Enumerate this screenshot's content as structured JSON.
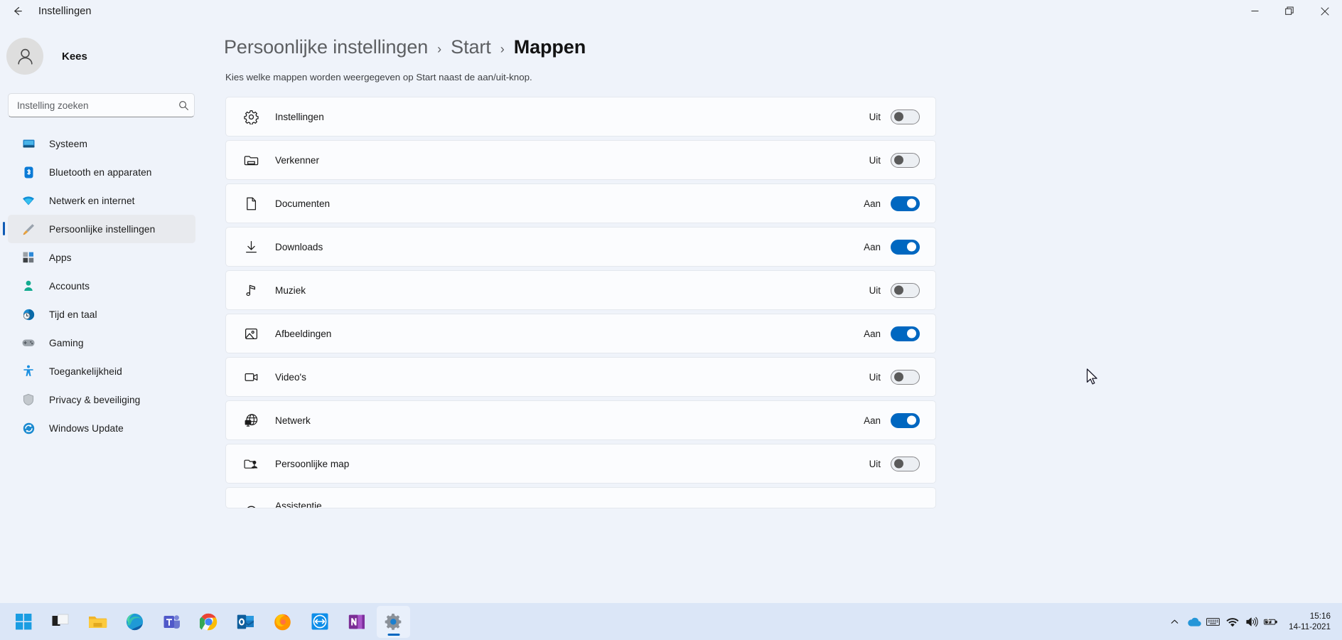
{
  "window": {
    "back_label": "back-arrow",
    "title": "Instellingen",
    "minimize": "minimize",
    "restore": "restore",
    "close": "close"
  },
  "sidebar": {
    "profile_name": "Kees",
    "search": {
      "placeholder": "Instelling zoeken",
      "value": ""
    },
    "items": [
      {
        "label": "Systeem",
        "icon": "monitor-icon",
        "active": false
      },
      {
        "label": "Bluetooth en apparaten",
        "icon": "bluetooth-icon",
        "active": false
      },
      {
        "label": "Netwerk en internet",
        "icon": "wifi-icon",
        "active": false
      },
      {
        "label": "Persoonlijke instellingen",
        "icon": "paintbrush-icon",
        "active": true
      },
      {
        "label": "Apps",
        "icon": "apps-icon",
        "active": false
      },
      {
        "label": "Accounts",
        "icon": "account-icon",
        "active": false
      },
      {
        "label": "Tijd en taal",
        "icon": "clock-globe-icon",
        "active": false
      },
      {
        "label": "Gaming",
        "icon": "gamepad-icon",
        "active": false
      },
      {
        "label": "Toegankelijkheid",
        "icon": "accessibility-icon",
        "active": false
      },
      {
        "label": "Privacy & beveiliging",
        "icon": "shield-icon",
        "active": false
      },
      {
        "label": "Windows Update",
        "icon": "update-icon",
        "active": false
      }
    ]
  },
  "main": {
    "breadcrumb": [
      {
        "label": "Persoonlijke instellingen",
        "current": false
      },
      {
        "label": "Start",
        "current": false
      },
      {
        "label": "Mappen",
        "current": true
      }
    ],
    "separator": "›",
    "description": "Kies welke mappen worden weergegeven op Start naast de aan/uit-knop.",
    "rows": [
      {
        "label": "Instellingen",
        "icon": "gear-icon",
        "state": "Uit",
        "on": false
      },
      {
        "label": "Verkenner",
        "icon": "folder-icon",
        "state": "Uit",
        "on": false
      },
      {
        "label": "Documenten",
        "icon": "document-icon",
        "state": "Aan",
        "on": true
      },
      {
        "label": "Downloads",
        "icon": "download-icon",
        "state": "Aan",
        "on": true
      },
      {
        "label": "Muziek",
        "icon": "music-note-icon",
        "state": "Uit",
        "on": false
      },
      {
        "label": "Afbeeldingen",
        "icon": "image-icon",
        "state": "Aan",
        "on": true
      },
      {
        "label": "Video's",
        "icon": "video-camera-icon",
        "state": "Uit",
        "on": false
      },
      {
        "label": "Netwerk",
        "icon": "network-globe-icon",
        "state": "Aan",
        "on": true
      },
      {
        "label": "Persoonlijke map",
        "icon": "personal-folder-icon",
        "state": "Uit",
        "on": false
      },
      {
        "label": "Assistentie",
        "icon": "assist-icon",
        "state": "",
        "on": false,
        "clipped": true
      }
    ]
  },
  "taskbar": {
    "apps": [
      {
        "name": "start-button",
        "indicator": "none"
      },
      {
        "name": "task-view-button",
        "indicator": "none"
      },
      {
        "name": "file-explorer",
        "indicator": "none"
      },
      {
        "name": "microsoft-edge",
        "indicator": "none"
      },
      {
        "name": "microsoft-teams",
        "indicator": "dot"
      },
      {
        "name": "google-chrome",
        "indicator": "dot"
      },
      {
        "name": "microsoft-outlook",
        "indicator": "none"
      },
      {
        "name": "mozilla-firefox",
        "indicator": "dot"
      },
      {
        "name": "teamviewer",
        "indicator": "none"
      },
      {
        "name": "microsoft-onenote",
        "indicator": "dot"
      },
      {
        "name": "settings",
        "indicator": "bar"
      }
    ],
    "tray": [
      "chevron-up-icon",
      "onedrive-icon",
      "keyboard-icon",
      "wifi-icon",
      "volume-icon",
      "battery-icon"
    ],
    "time": "15:16",
    "date": "14-11-2021"
  },
  "colors": {
    "background": "#eff3fa",
    "card": "#fbfcfe",
    "accent": "#0067c0",
    "taskbar": "#dbe6f7",
    "active_nav": "#e8eaee"
  }
}
